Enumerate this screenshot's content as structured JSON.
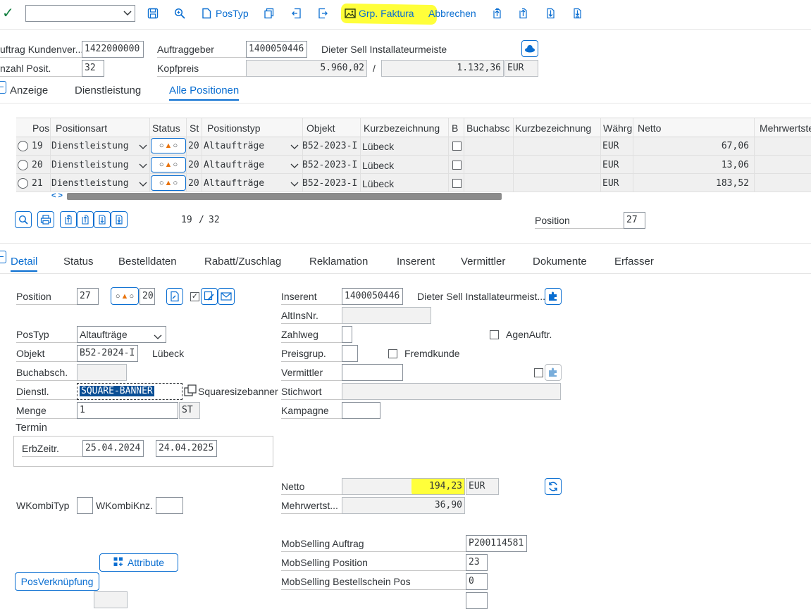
{
  "toolbar": {
    "command_field_value": "",
    "postyp_label": "PosTyp",
    "grp_faktura_label": "Grp. Faktura",
    "abbrechen_label": "Abbrechen"
  },
  "header": {
    "auftrag_label": "uftrag Kundenver...",
    "auftrag_value": "1422000000",
    "anzahl_label": "nzahl Posit.",
    "anzahl_value": "32",
    "auftraggeber_label": "Auftraggeber",
    "auftraggeber_value": "1400050446",
    "auftraggeber_name": "Dieter Sell Installateurmeiste",
    "kopfpreis_label": "Kopfpreis",
    "kopfpreis_value": "5.960,02",
    "separator": "/",
    "kopfpreis_value2": "1.132,36",
    "currency": "EUR"
  },
  "top_tabs": [
    "Anzeige",
    "Dienstleistung",
    "Alle Positionen"
  ],
  "table": {
    "columns": [
      "Pos",
      "Positionsart",
      "Status",
      "St",
      "Positionstyp",
      "Objekt",
      "Kurzbezeichnung",
      "B",
      "Buchabsc",
      "Kurzbezeichnung",
      "Währg",
      "Netto",
      "Mehrwertste"
    ],
    "rows": [
      {
        "pos": "19",
        "art": "Dienstleistung",
        "st": "20",
        "typ": "Altaufträge",
        "objekt": "B52-2023-I",
        "kurz": "Lübeck",
        "curr": "EUR",
        "netto": "67,06"
      },
      {
        "pos": "20",
        "art": "Dienstleistung",
        "st": "20",
        "typ": "Altaufträge",
        "objekt": "B52-2023-I",
        "kurz": "Lübeck",
        "curr": "EUR",
        "netto": "13,06"
      },
      {
        "pos": "21",
        "art": "Dienstleistung",
        "st": "20",
        "typ": "Altaufträge",
        "objekt": "B52-2023-I",
        "kurz": "Lübeck",
        "curr": "EUR",
        "netto": "183,52"
      }
    ],
    "scroll_arrows": "< >"
  },
  "pager": {
    "current": "19",
    "sep": "/",
    "total": "32",
    "position_label": "Position",
    "position_value": "27"
  },
  "detail_tabs": [
    "Detail",
    "Status",
    "Bestelldaten",
    "Rabatt/Zuschlag",
    "Reklamation",
    "Inserent",
    "Vermittler",
    "Dokumente",
    "Erfasser"
  ],
  "detail": {
    "position_label": "Position",
    "position_value": "27",
    "status_num": "20",
    "postyp_label": "PosTyp",
    "postyp_value": "Altaufträge",
    "objekt_label": "Objekt",
    "objekt_value": "B52-2024-I",
    "objekt_name": "Lübeck",
    "buchabsch_label": "Buchabsch.",
    "dienstl_label": "Dienstl.",
    "dienstl_value": "SQUARE-BANNER",
    "dienstl_desc": "Squaresizebanner",
    "menge_label": "Menge",
    "menge_value": "1",
    "menge_unit": "ST",
    "termin_title": "Termin",
    "erbzeitr_label": "ErbZeitr.",
    "erb_from": "25.04.2024",
    "erb_to": "24.04.2025",
    "wkombityp_label": "WKombiTyp",
    "wkombiknz_label": "WKombiKnz.",
    "attribute_label": "Attribute",
    "posverk_label": "PosVerknüpfung",
    "inserent_label": "Inserent",
    "inserent_value": "1400050446",
    "inserent_name": "Dieter Sell Installateurmeist...",
    "altinsnr_label": "AltInsNr.",
    "zahlweg_label": "Zahlweg",
    "agenauftr_label": "AgenAuftr.",
    "preisgrup_label": "Preisgrup.",
    "fremdkunde_label": "Fremdkunde",
    "vermittler_label": "Vermittler",
    "stichwort_label": "Stichwort",
    "kampagne_label": "Kampagne",
    "netto_label": "Netto",
    "netto_value": "194,23",
    "netto_curr": "EUR",
    "mwst_label": "Mehrwertst...",
    "mwst_value": "36,90",
    "mob_auftrag_label": "MobSelling Auftrag",
    "mob_auftrag_value": "P200114581",
    "mob_position_label": "MobSelling Position",
    "mob_position_value": "23",
    "mob_bestell_label": "MobSelling Bestellschein Pos",
    "mob_bestell_value": "0"
  },
  "colors": {
    "accent": "#0a6ed1",
    "highlight": "#ffff3a",
    "ok_green": "#107e3e"
  }
}
